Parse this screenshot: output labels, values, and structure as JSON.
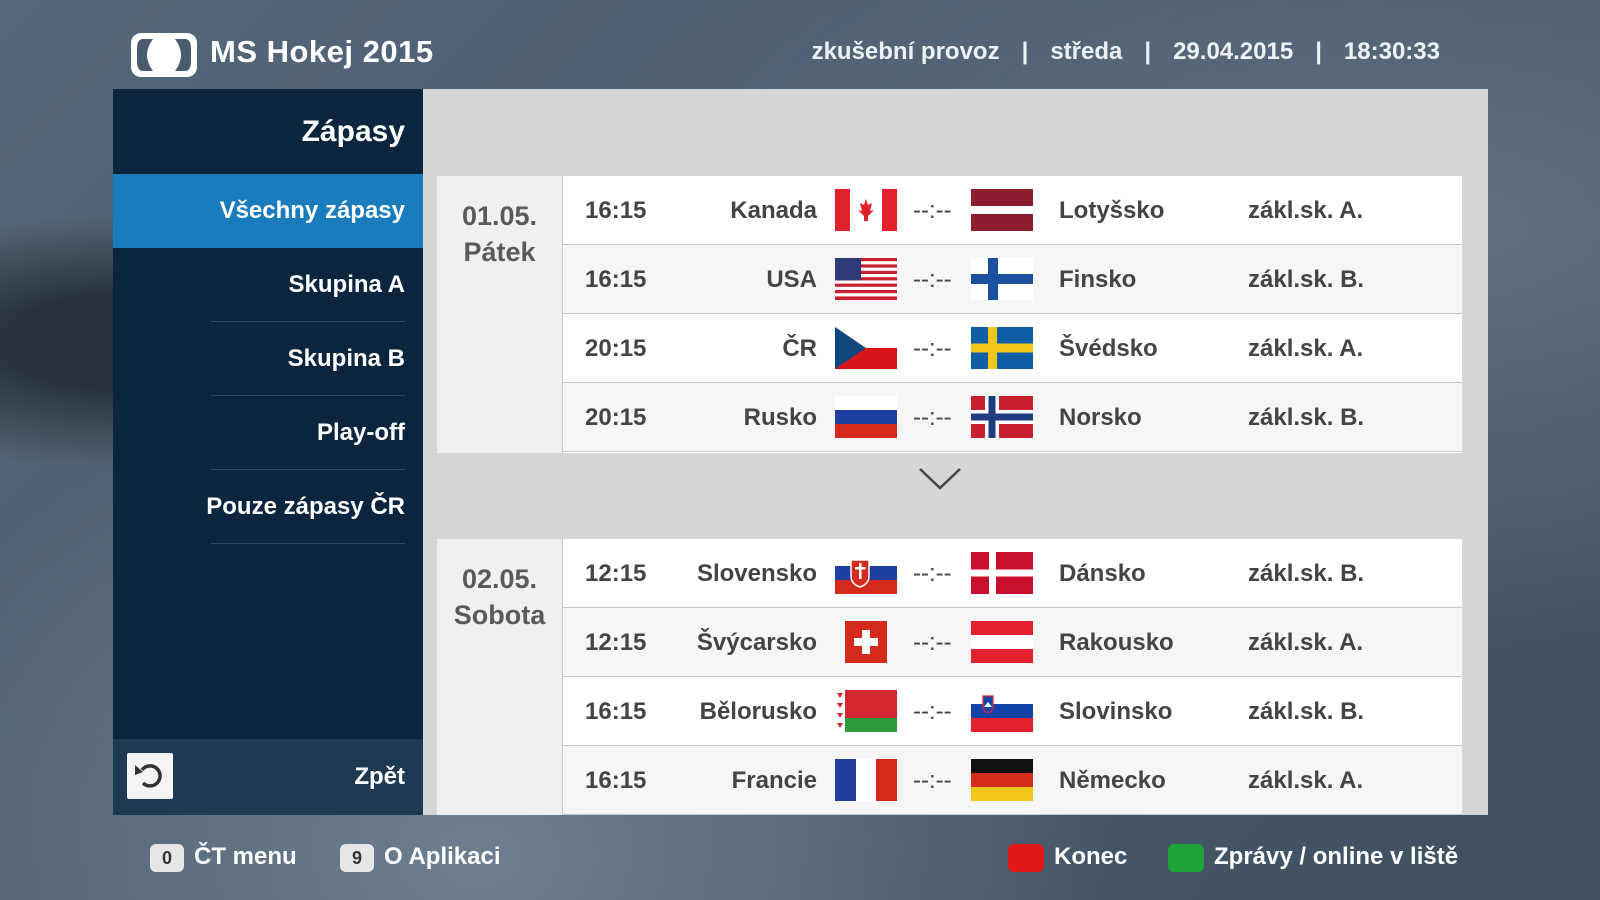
{
  "header": {
    "title": "MS Hokej 2015",
    "mode": "zkušební provoz",
    "day": "středa",
    "date": "29.04.2015",
    "time": "18:30:33"
  },
  "sidebar": {
    "title": "Zápasy",
    "items": [
      {
        "label": "Všechny zápasy",
        "active": true
      },
      {
        "label": "Skupina A"
      },
      {
        "label": "Skupina B"
      },
      {
        "label": "Play-off"
      },
      {
        "label": "Pouze zápasy ČR"
      }
    ],
    "back_label": "Zpět"
  },
  "days": [
    {
      "date": "01.05.",
      "weekday": "Pátek",
      "matches": [
        {
          "time": "16:15",
          "home": "Kanada",
          "home_flag": "canada-flag-icon",
          "score": "--:--",
          "away": "Lotyšsko",
          "away_flag": "latvia-flag-icon",
          "group": "zákl.sk. A."
        },
        {
          "time": "16:15",
          "home": "USA",
          "home_flag": "usa-flag-icon",
          "score": "--:--",
          "away": "Finsko",
          "away_flag": "finland-flag-icon",
          "group": "zákl.sk. B."
        },
        {
          "time": "20:15",
          "home": "ČR",
          "home_flag": "czech-flag-icon",
          "score": "--:--",
          "away": "Švédsko",
          "away_flag": "sweden-flag-icon",
          "group": "zákl.sk. A."
        },
        {
          "time": "20:15",
          "home": "Rusko",
          "home_flag": "russia-flag-icon",
          "score": "--:--",
          "away": "Norsko",
          "away_flag": "norway-flag-icon",
          "group": "zákl.sk. B."
        }
      ]
    },
    {
      "date": "02.05.",
      "weekday": "Sobota",
      "matches": [
        {
          "time": "12:15",
          "home": "Slovensko",
          "home_flag": "slovakia-flag-icon",
          "score": "--:--",
          "away": "Dánsko",
          "away_flag": "denmark-flag-icon",
          "group": "zákl.sk. B."
        },
        {
          "time": "12:15",
          "home": "Švýcarsko",
          "home_flag": "switzerland-flag-icon",
          "score": "--:--",
          "away": "Rakousko",
          "away_flag": "austria-flag-icon",
          "group": "zákl.sk. A."
        },
        {
          "time": "16:15",
          "home": "Bělorusko",
          "home_flag": "belarus-flag-icon",
          "score": "--:--",
          "away": "Slovinsko",
          "away_flag": "slovenia-flag-icon",
          "group": "zákl.sk. B."
        },
        {
          "time": "16:15",
          "home": "Francie",
          "home_flag": "france-flag-icon",
          "score": "--:--",
          "away": "Německo",
          "away_flag": "germany-flag-icon",
          "group": "zákl.sk. A."
        }
      ]
    }
  ],
  "footer": {
    "left": [
      {
        "key": "0",
        "label": "ČT menu"
      },
      {
        "key": "9",
        "label": "O Aplikaci"
      }
    ],
    "right": [
      {
        "color": "#e01818",
        "label": "Konec"
      },
      {
        "color": "#1fa43a",
        "label": "Zprávy / online v liště"
      }
    ]
  },
  "colors": {
    "sidebar_bg": "#0c253e",
    "active_item": "#1a7bbd",
    "panel_bg": "#d6d6d6"
  }
}
